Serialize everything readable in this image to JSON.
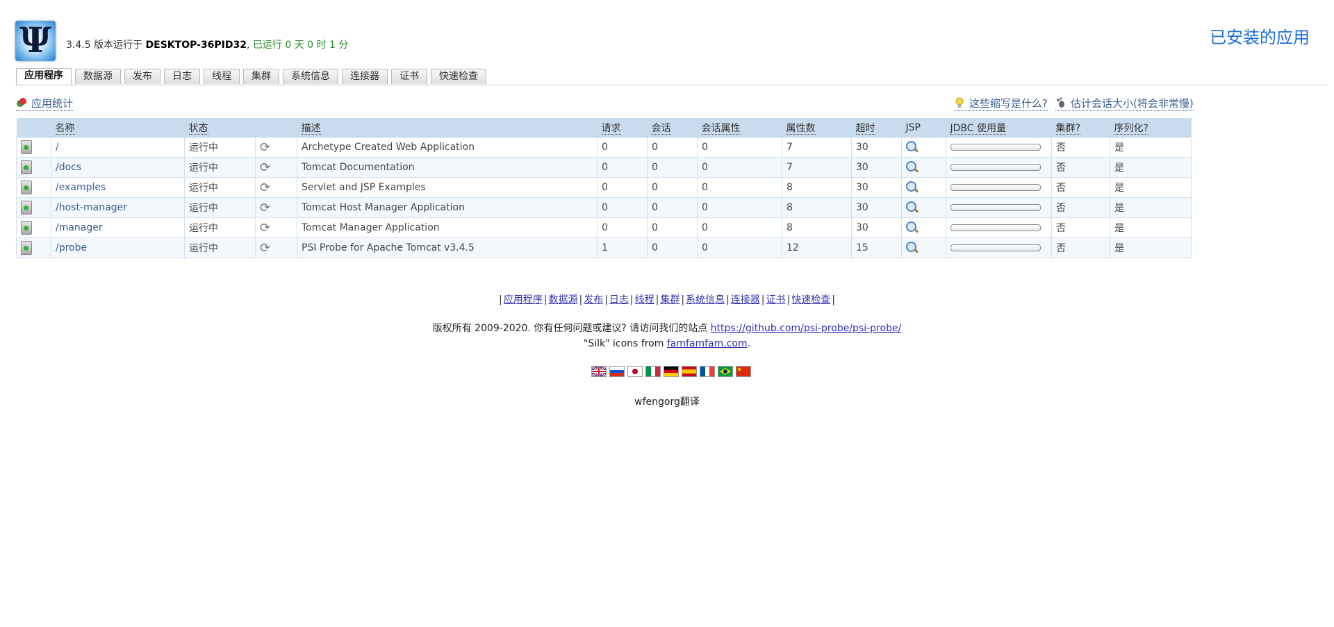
{
  "header": {
    "logo_text": "Ψ",
    "version_text": "3.4.5 版本运行于 ",
    "host": "DESKTOP-36PID32",
    "separator": ", ",
    "uptime": "已运行 0 天 0 时 1 分",
    "page_title": "已安装的应用"
  },
  "tabs": [
    "应用程序",
    "数据源",
    "发布",
    "日志",
    "线程",
    "集群",
    "系统信息",
    "连接器",
    "证书",
    "快速检查"
  ],
  "toolbar": {
    "app_stats": "应用统计",
    "what_abbrev": "这些缩写是什么?",
    "estimate_session": "估计会话大小(将会非常慢)"
  },
  "table": {
    "headers": [
      "名称",
      "状态",
      "描述",
      "请求",
      "会话",
      "会话属性",
      "属性数",
      "超时",
      "JSP",
      "JDBC 使用量",
      "集群?",
      "序列化?"
    ],
    "rows": [
      {
        "name": "/",
        "status": "运行中",
        "desc": "Archetype Created Web Application",
        "req": "0",
        "sess": "0",
        "sattr": "0",
        "attrs": "7",
        "timeout": "30",
        "cluster": "否",
        "serial": "是"
      },
      {
        "name": "/docs",
        "status": "运行中",
        "desc": "Tomcat Documentation",
        "req": "0",
        "sess": "0",
        "sattr": "0",
        "attrs": "7",
        "timeout": "30",
        "cluster": "否",
        "serial": "是"
      },
      {
        "name": "/examples",
        "status": "运行中",
        "desc": "Servlet and JSP Examples",
        "req": "0",
        "sess": "0",
        "sattr": "0",
        "attrs": "8",
        "timeout": "30",
        "cluster": "否",
        "serial": "是"
      },
      {
        "name": "/host-manager",
        "status": "运行中",
        "desc": "Tomcat Host Manager Application",
        "req": "0",
        "sess": "0",
        "sattr": "0",
        "attrs": "8",
        "timeout": "30",
        "cluster": "否",
        "serial": "是"
      },
      {
        "name": "/manager",
        "status": "运行中",
        "desc": "Tomcat Manager Application",
        "req": "0",
        "sess": "0",
        "sattr": "0",
        "attrs": "8",
        "timeout": "30",
        "cluster": "否",
        "serial": "是"
      },
      {
        "name": "/probe",
        "status": "运行中",
        "desc": "PSI Probe for Apache Tomcat v3.4.5",
        "req": "1",
        "sess": "0",
        "sattr": "0",
        "attrs": "12",
        "timeout": "15",
        "cluster": "否",
        "serial": "是"
      }
    ]
  },
  "footer": {
    "nav": [
      "应用程序",
      "数据源",
      "发布",
      "日志",
      "线程",
      "集群",
      "系统信息",
      "连接器",
      "证书",
      "快速检查"
    ],
    "copyright_text": "版权所有 2009-2020. 你有任何问题或建议? 请访问我们的站点 ",
    "copyright_link": "https://github.com/psi-probe/psi-probe/",
    "silk_prefix": "\"Silk\" icons from ",
    "silk_link": "famfamfam.com",
    "silk_suffix": ".",
    "flags": [
      "gb-flag-icon",
      "ru-flag-icon",
      "jp-flag-icon",
      "it-flag-icon",
      "de-flag-icon",
      "es-flag-icon",
      "fr-flag-icon",
      "br-flag-icon",
      "cn-flag-icon"
    ],
    "translator": "wfengorg翻译"
  },
  "colors": {
    "accent": "#1b6fd6",
    "running": "#2a8a2a",
    "no": "#d0202a",
    "header_bg": "#c9dced"
  }
}
